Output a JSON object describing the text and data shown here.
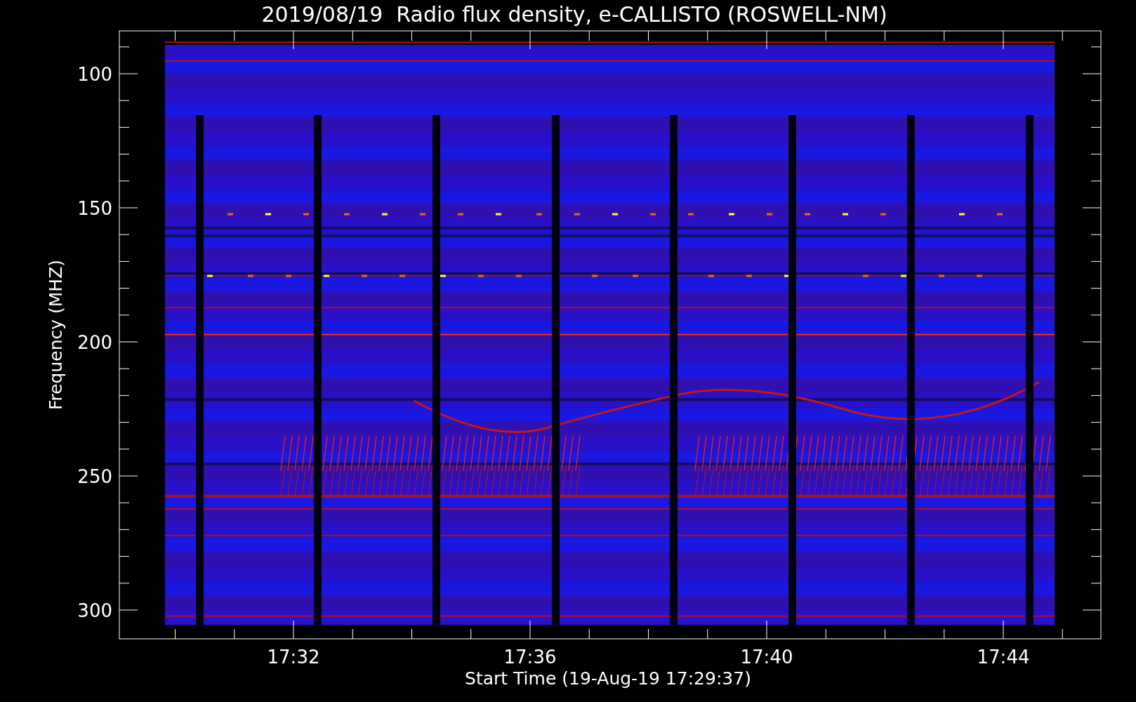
{
  "title": "2019/08/19  Radio flux density, e-CALLISTO (ROSWELL-NM)",
  "ylabel": "Frequency (MHZ)",
  "xlabel": "Start Time (19-Aug-19 17:29:37)",
  "yticks": [
    "100",
    "150",
    "200",
    "250",
    "300"
  ],
  "xticks": [
    "17:32",
    "17:36",
    "17:40",
    "17:44"
  ]
}
